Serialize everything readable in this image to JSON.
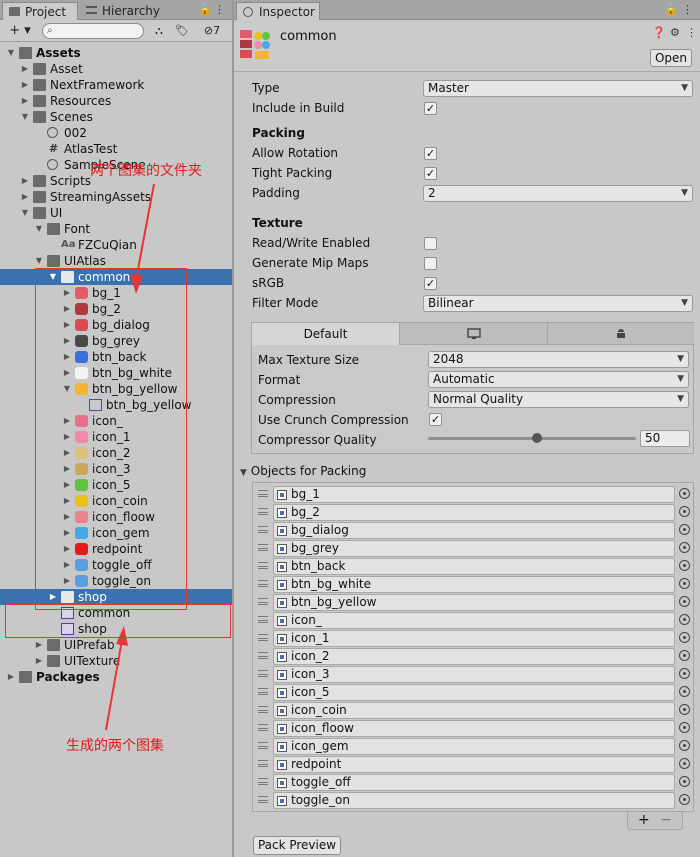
{
  "project": {
    "tab_project": "Project",
    "tab_hierarchy": "Hierarchy",
    "toolbar": {
      "add_label": "+ ▾",
      "hidden_count": "7"
    },
    "search_placeholder": "",
    "tree": [
      {
        "label": "Assets",
        "icon": "folder",
        "arrow": "down",
        "bold": true
      },
      {
        "label": "Asset",
        "icon": "folder",
        "arrow": "right"
      },
      {
        "label": "NextFramework",
        "icon": "folder",
        "arrow": "right"
      },
      {
        "label": "Resources",
        "icon": "folder",
        "arrow": "right"
      },
      {
        "label": "Scenes",
        "icon": "folder",
        "arrow": "down"
      },
      {
        "label": "002",
        "icon": "scene"
      },
      {
        "label": "AtlasTest",
        "icon": "script"
      },
      {
        "label": "SampleScene",
        "icon": "scene"
      },
      {
        "label": "Scripts",
        "icon": "folder",
        "arrow": "right"
      },
      {
        "label": "StreamingAssets",
        "icon": "folder",
        "arrow": "right"
      },
      {
        "label": "UI",
        "icon": "folder",
        "arrow": "down"
      },
      {
        "label": "Font",
        "icon": "folder",
        "arrow": "down"
      },
      {
        "label": "FZCuQian",
        "icon": "font"
      },
      {
        "label": "UIAtlas",
        "icon": "folder",
        "arrow": "down"
      },
      {
        "label": "common",
        "icon": "folder-open",
        "arrow": "down",
        "selected": true
      },
      {
        "label": "bg_1",
        "icon": "sprite",
        "color": "#e55a6a",
        "arrow": "right"
      },
      {
        "label": "bg_2",
        "icon": "sprite",
        "color": "#b0383f",
        "arrow": "right"
      },
      {
        "label": "bg_dialog",
        "icon": "sprite",
        "color": "#d94c52",
        "arrow": "right"
      },
      {
        "label": "bg_grey",
        "icon": "sprite",
        "color": "#4a4a4a",
        "arrow": "right"
      },
      {
        "label": "btn_back",
        "icon": "sprite",
        "color": "#3a6fd8",
        "arrow": "right"
      },
      {
        "label": "btn_bg_white",
        "icon": "sprite",
        "color": "#f4f4f4",
        "arrow": "right"
      },
      {
        "label": "btn_bg_yellow",
        "icon": "sprite",
        "color": "#f2b630",
        "arrow": "down"
      },
      {
        "label": "btn_bg_yellow",
        "icon": "sprite-sub"
      },
      {
        "label": "icon_",
        "icon": "sprite",
        "color": "#e8708c",
        "arrow": "right"
      },
      {
        "label": "icon_1",
        "icon": "sprite",
        "color": "#f08aa8",
        "arrow": "right"
      },
      {
        "label": "icon_2",
        "icon": "sprite",
        "color": "#d9c27a",
        "arrow": "right"
      },
      {
        "label": "icon_3",
        "icon": "sprite",
        "color": "#c9a85a",
        "arrow": "right"
      },
      {
        "label": "icon_5",
        "icon": "sprite",
        "color": "#5cc43d",
        "arrow": "right"
      },
      {
        "label": "icon_coin",
        "icon": "sprite",
        "color": "#e8c21a",
        "arrow": "right"
      },
      {
        "label": "icon_floow",
        "icon": "sprite",
        "color": "#e9848f",
        "arrow": "right"
      },
      {
        "label": "icon_gem",
        "icon": "sprite",
        "color": "#43a9e8",
        "arrow": "right"
      },
      {
        "label": "redpoint",
        "icon": "sprite",
        "color": "#e31b1b",
        "arrow": "right"
      },
      {
        "label": "toggle_off",
        "icon": "sprite",
        "color": "#5aa0e0",
        "arrow": "right"
      },
      {
        "label": "toggle_on",
        "icon": "sprite",
        "color": "#5aa0e0",
        "arrow": "right"
      },
      {
        "label": "shop",
        "icon": "folder",
        "arrow": "right",
        "selected": true
      },
      {
        "label": "common",
        "icon": "atlas"
      },
      {
        "label": "shop",
        "icon": "atlas"
      },
      {
        "label": "UIPrefab",
        "icon": "folder",
        "arrow": "right"
      },
      {
        "label": "UITexture",
        "icon": "folder",
        "arrow": "right"
      },
      {
        "label": "Packages",
        "icon": "folder",
        "arrow": "right",
        "bold": true
      }
    ],
    "annotation_folder": "两个图集的文件夹",
    "annotation_atlas": "生成的两个图集"
  },
  "inspector": {
    "tab_label": "Inspector",
    "asset_name": "common",
    "open_label": "Open",
    "fields": {
      "type_label": "Type",
      "type_value": "Master",
      "include_label": "Include in Build",
      "include_checked": true,
      "packing_header": "Packing",
      "allow_rotation_label": "Allow Rotation",
      "allow_rotation_checked": true,
      "tight_packing_label": "Tight Packing",
      "tight_packing_checked": true,
      "padding_label": "Padding",
      "padding_value": "2",
      "texture_header": "Texture",
      "readwrite_label": "Read/Write Enabled",
      "readwrite_checked": false,
      "mipmaps_label": "Generate Mip Maps",
      "mipmaps_checked": false,
      "srgb_label": "sRGB",
      "srgb_checked": true,
      "filter_label": "Filter Mode",
      "filter_value": "Bilinear"
    },
    "platform": {
      "tab_default": "Default",
      "tab_standalone_icon": "monitor-icon",
      "tab_android_icon": "android-icon",
      "max_size_label": "Max Texture Size",
      "max_size_value": "2048",
      "format_label": "Format",
      "format_value": "Automatic",
      "compression_label": "Compression",
      "compression_value": "Normal Quality",
      "crunch_label": "Use Crunch Compression",
      "crunch_checked": true,
      "quality_label": "Compressor Quality",
      "quality_value": "50"
    },
    "objects_header": "Objects for Packing",
    "objects": [
      "bg_1",
      "bg_2",
      "bg_dialog",
      "bg_grey",
      "btn_back",
      "btn_bg_white",
      "btn_bg_yellow",
      "icon_",
      "icon_1",
      "icon_2",
      "icon_3",
      "icon_5",
      "icon_coin",
      "icon_floow",
      "icon_gem",
      "redpoint",
      "toggle_off",
      "toggle_on"
    ],
    "add_label": "+",
    "remove_label": "−",
    "pack_preview_label": "Pack Preview"
  },
  "colors": {
    "selection": "#3a72b0",
    "annotation": "#e53535"
  }
}
